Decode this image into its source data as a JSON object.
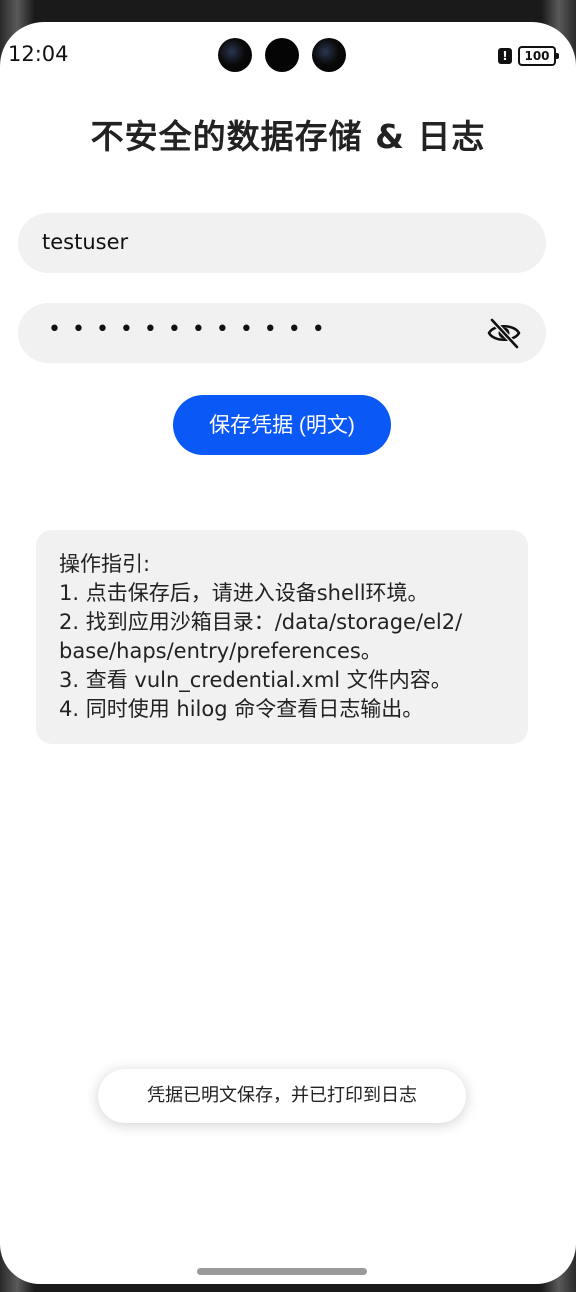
{
  "status_bar": {
    "time": "12:04",
    "alert_icon": "!",
    "battery_level": "100"
  },
  "page": {
    "title": "不安全的数据存储 & 日志"
  },
  "form": {
    "username_value": "testuser",
    "password_dots": "••••••••••••",
    "password_visibility_icon": "eye-off-icon",
    "save_button_label": "保存凭据 (明文)"
  },
  "guide": {
    "lines": [
      "操作指引:",
      "1. 点击保存后，请进入设备shell环境。",
      "2. 找到应用沙箱目录：/data/storage/el2/",
      "base/haps/entry/preferences。",
      "3. 查看 vuln_credential.xml 文件内容。",
      "4. 同时使用 hilog 命令查看日志输出。"
    ]
  },
  "toast": {
    "message": "凭据已明文保存，并已打印到日志"
  },
  "colors": {
    "accent": "#0a59f7",
    "field_background": "#f1f1f1"
  }
}
